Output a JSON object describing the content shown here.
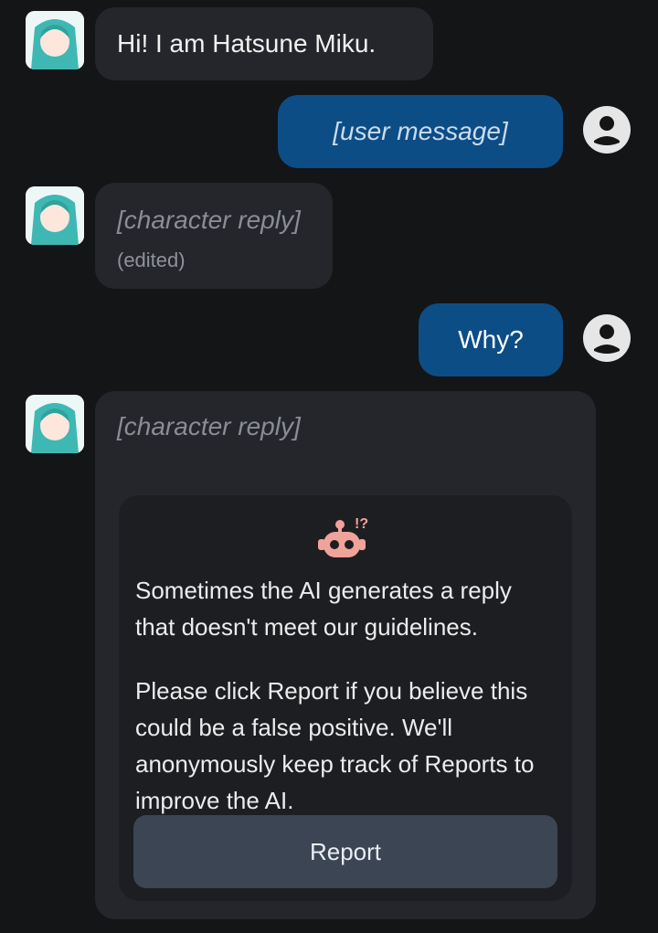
{
  "messages": {
    "m1": {
      "text": "Hi! I am Hatsune Miku."
    },
    "m2": {
      "text": "[user message]"
    },
    "m3": {
      "text": "[character reply]",
      "edited": "(edited)"
    },
    "m4": {
      "text": "Why?"
    },
    "m5": {
      "text": "[character reply]"
    }
  },
  "notice": {
    "icon": "robot-warning-icon",
    "line1": "Sometimes the AI generates a reply that doesn't meet our guidelines.",
    "line2": "Please click Report if you believe this could be a false positive. We'll anonymously keep track of Reports to improve the AI.",
    "report_label": "Report"
  },
  "colors": {
    "background": "#141517",
    "bot_bubble": "#24262b",
    "user_bubble": "#0d4d86",
    "report_button": "#3c4553",
    "robot_icon": "#f0a39a"
  }
}
